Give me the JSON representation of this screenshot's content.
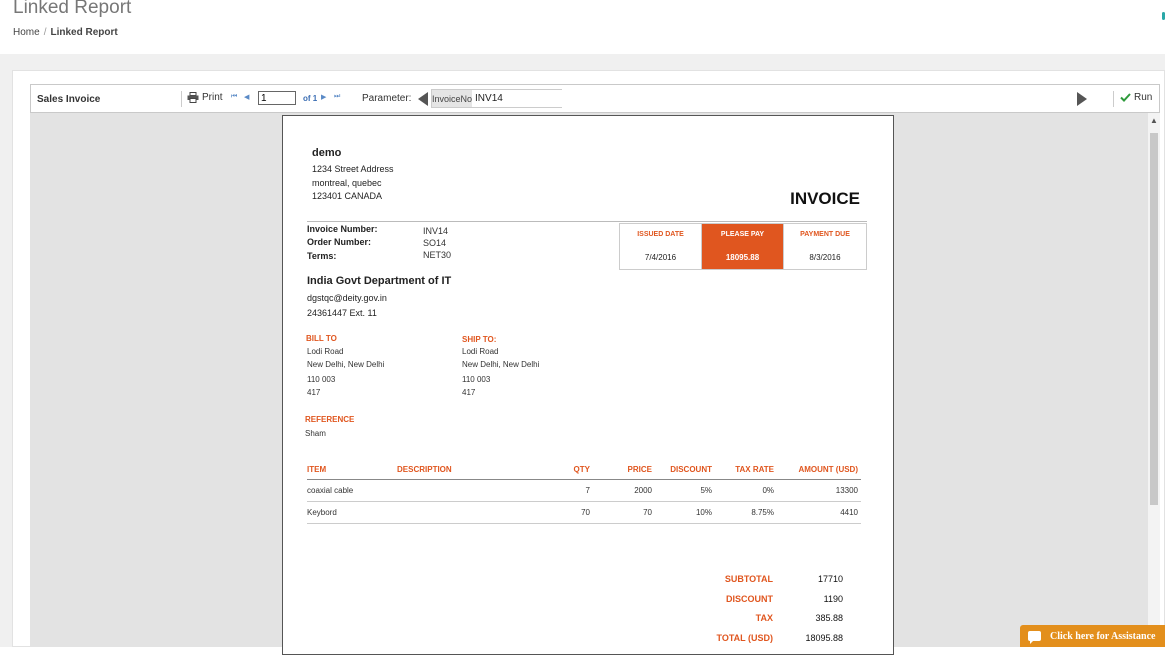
{
  "header": {
    "title": "Linked Report",
    "breadcrumb": [
      "Home",
      "Linked Report"
    ]
  },
  "toolbar": {
    "report_name": "Sales Invoice",
    "print_label": "Print",
    "page_current": "1",
    "page_of": "of 1",
    "parameter_label": "Parameter:",
    "param_name": "InvoiceNo",
    "param_value": "INV14",
    "run_label": "Run"
  },
  "invoice": {
    "company": {
      "name": "demo",
      "address1": "1234 Street Address",
      "address2": "montreal, quebec",
      "address3": "123401 CANADA"
    },
    "title": "INVOICE",
    "info": {
      "invoice_number_label": "Invoice Number:",
      "invoice_number": "INV14",
      "order_number_label": "Order Number:",
      "order_number": "SO14",
      "terms_label": "Terms:",
      "terms": "NET30"
    },
    "summary": {
      "issued_label": "ISSUED DATE",
      "issued": "7/4/2016",
      "pay_label": "PLEASE PAY",
      "pay": "18095.88",
      "due_label": "PAYMENT DUE",
      "due": "8/3/2016"
    },
    "customer": {
      "name": "India Govt Department of IT",
      "email": "dgstqc@deity.gov.in",
      "phone": "24361447 Ext. 11"
    },
    "bill_to": {
      "label": "BILL TO",
      "lines": [
        "Lodi Road",
        "New Delhi, New Delhi",
        "110 003",
        "417"
      ]
    },
    "ship_to": {
      "label": "SHIP TO:",
      "lines": [
        "Lodi Road",
        "New Delhi, New Delhi",
        "110 003",
        "417"
      ]
    },
    "reference": {
      "label": "REFERENCE",
      "value": "Sham"
    },
    "columns": {
      "item": "ITEM",
      "description": "DESCRIPTION",
      "qty": "QTY",
      "price": "PRICE",
      "discount": "DISCOUNT",
      "tax_rate": "TAX RATE",
      "amount": "AMOUNT (USD)"
    },
    "items": [
      {
        "item": "coaxial cable",
        "description": "",
        "qty": "7",
        "price": "2000",
        "discount": "5%",
        "tax_rate": "0%",
        "amount": "13300"
      },
      {
        "item": "Keybord",
        "description": "",
        "qty": "70",
        "price": "70",
        "discount": "10%",
        "tax_rate": "8.75%",
        "amount": "4410"
      }
    ],
    "totals": {
      "subtotal_label": "SUBTOTAL",
      "subtotal": "17710",
      "discount_label": "DISCOUNT",
      "discount": "1190",
      "tax_label": "TAX",
      "tax": "385.88",
      "total_label": "TOTAL (USD)",
      "total": "18095.88"
    }
  },
  "assist": {
    "label": "Click here for Assistance"
  },
  "colors": {
    "accent": "#e0561f",
    "assist": "#e38f1c"
  }
}
